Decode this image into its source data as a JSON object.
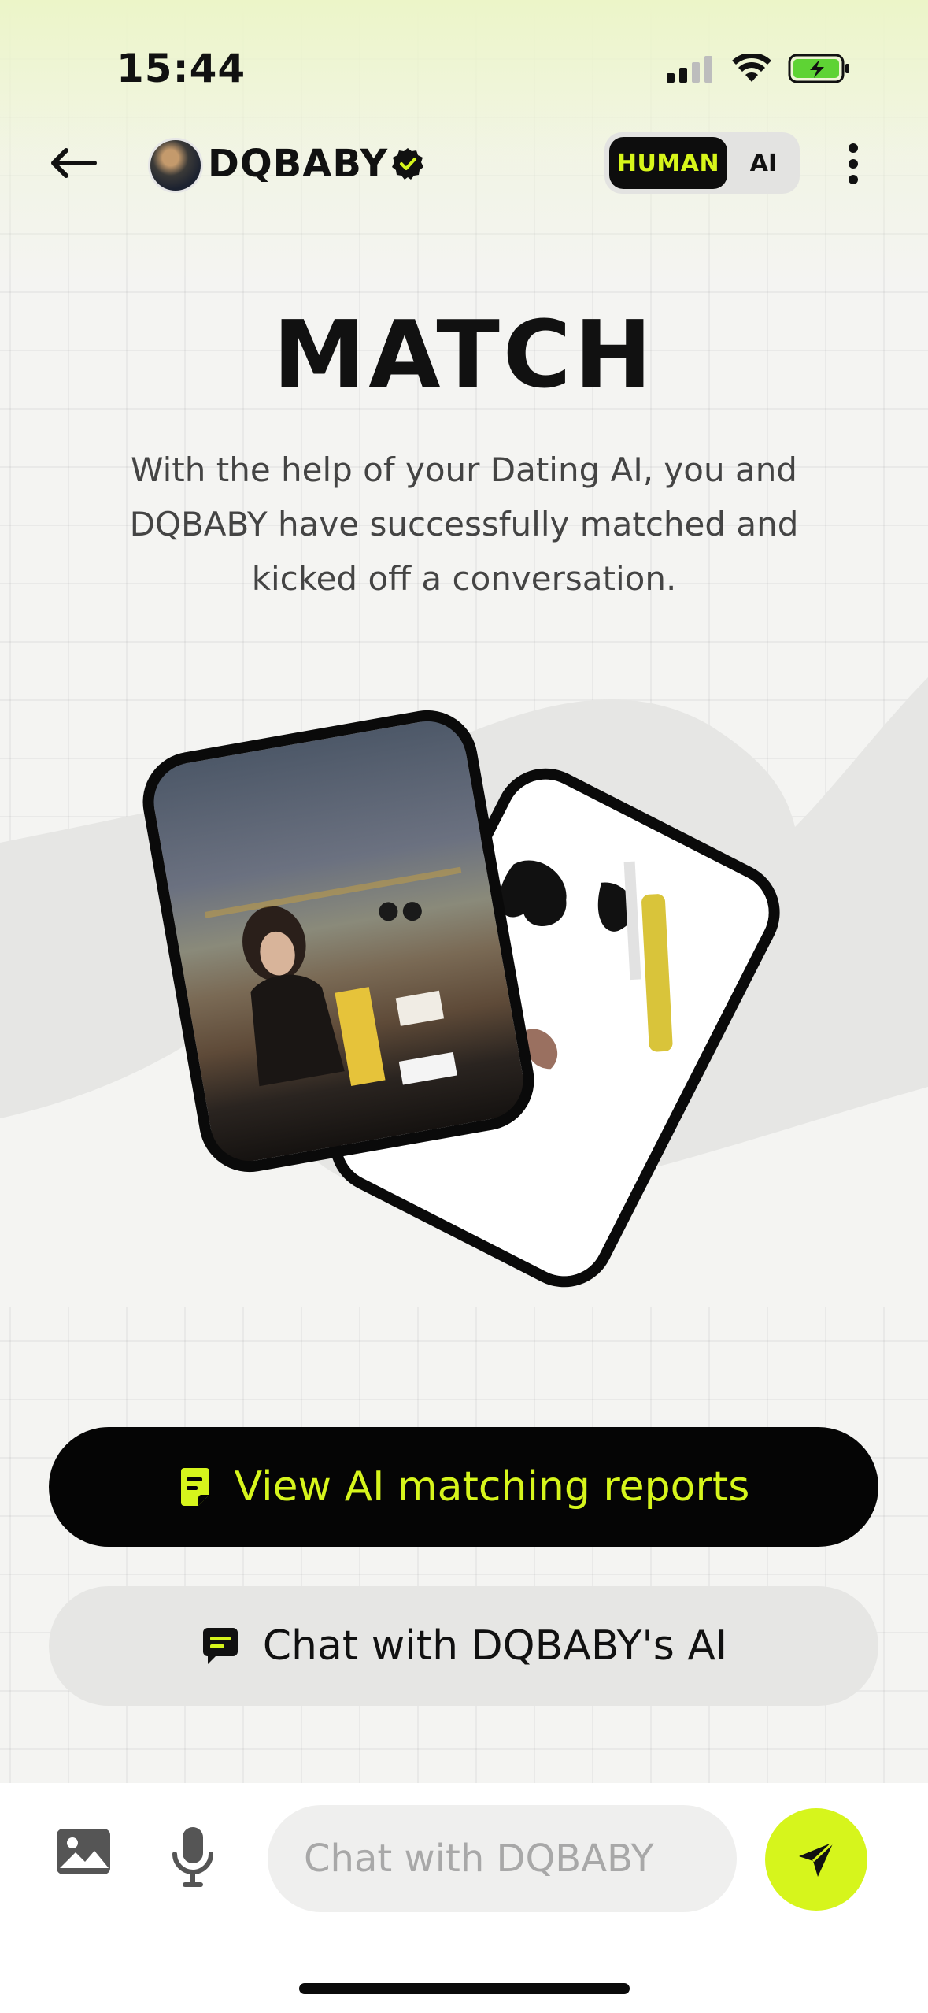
{
  "status_bar": {
    "time": "15:44",
    "icons": [
      "cellular-signal-icon",
      "wifi-icon",
      "battery-charging-icon"
    ],
    "battery_color": "#5ed334"
  },
  "nav": {
    "back_icon": "arrow-left-icon",
    "profile_name": "DQBABY",
    "verified_icon": "verified-badge-icon",
    "mode_toggle": {
      "options": [
        "HUMAN",
        "AI"
      ],
      "selected": "HUMAN"
    },
    "more_icon": "more-vertical-icon"
  },
  "match": {
    "title": "MATCH",
    "description": "With the help of your Dating AI, you and DQBABY have successfully matched and kicked off a conversation."
  },
  "actions": {
    "primary": {
      "label": "View AI matching reports",
      "icon": "report-icon"
    },
    "secondary": {
      "label": "Chat with DQBABY's AI",
      "icon": "chat-bubble-icon"
    }
  },
  "composer": {
    "image_icon": "image-icon",
    "mic_icon": "microphone-icon",
    "placeholder": "Chat with DQBABY",
    "value": "",
    "send_icon": "send-icon"
  },
  "colors": {
    "accent": "#d6f51c",
    "dark": "#050505",
    "background": "#f4f4f2"
  }
}
